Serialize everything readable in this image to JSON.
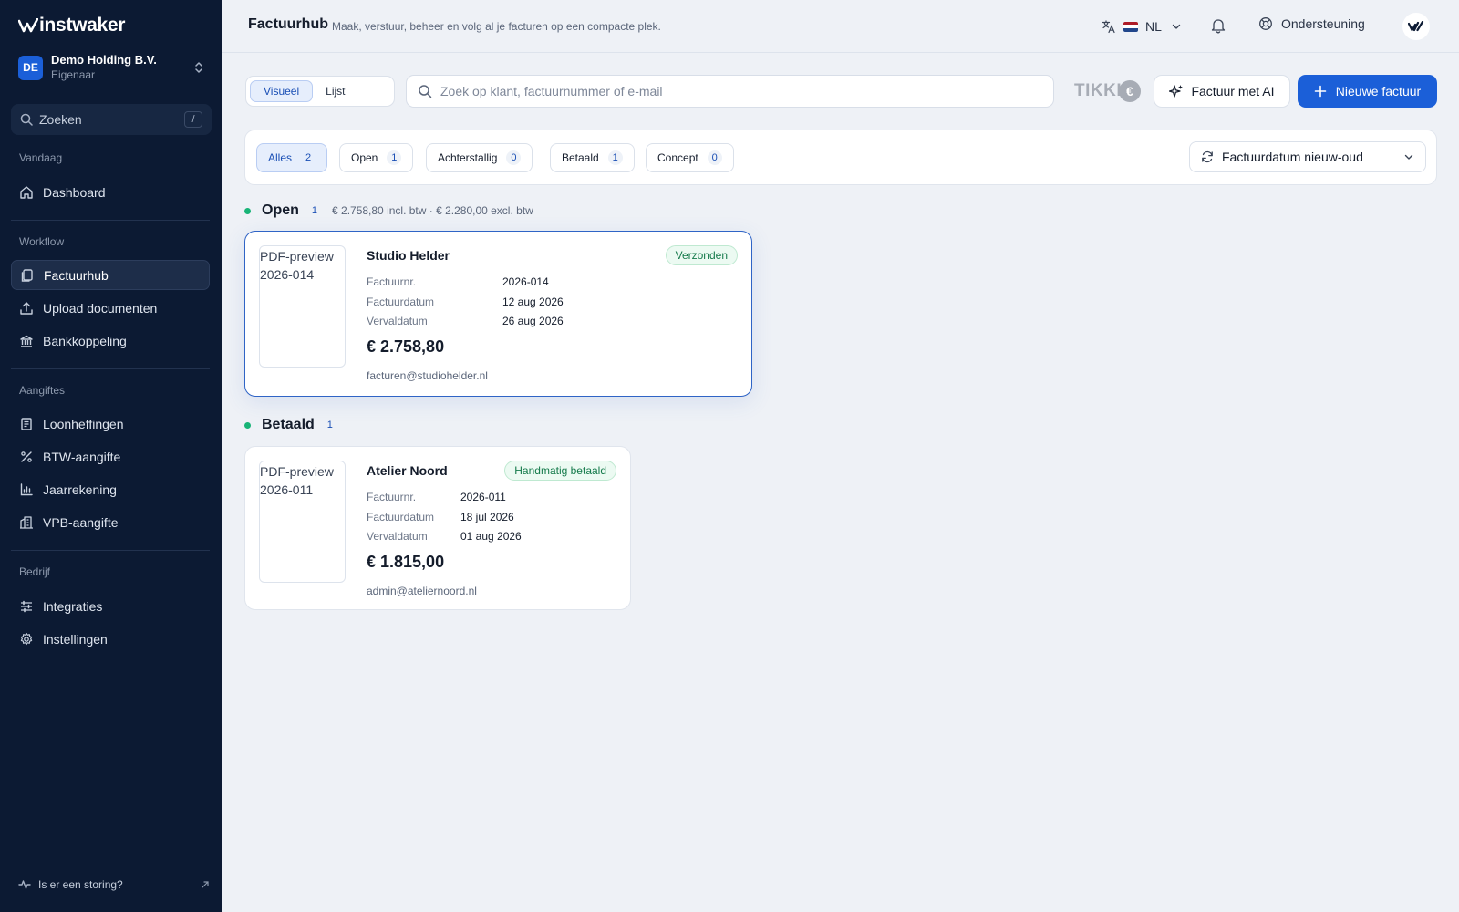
{
  "sidebar": {
    "brand": "instwaker",
    "org": {
      "initials": "DE",
      "name": "Demo Holding B.V.",
      "role": "Eigenaar"
    },
    "search": {
      "label": "Zoeken",
      "shortcut": "/"
    },
    "sections": {
      "today": "Vandaag",
      "workflow": "Workflow",
      "filings": "Aangiftes",
      "company": "Bedrijf"
    },
    "items": [
      {
        "label": "Dashboard",
        "icon": "home-icon"
      },
      {
        "label": "Factuurhub",
        "icon": "files-icon",
        "active": true
      },
      {
        "label": "Upload documenten",
        "icon": "upload-icon"
      },
      {
        "label": "Bankkoppeling",
        "icon": "bank-icon"
      },
      {
        "label": "Loonheffingen",
        "icon": "receipt-icon"
      },
      {
        "label": "BTW-aangifte",
        "icon": "percent-icon"
      },
      {
        "label": "Jaarrekening",
        "icon": "bar-chart-icon"
      },
      {
        "label": "VPB-aangifte",
        "icon": "building-icon"
      },
      {
        "label": "Integraties",
        "icon": "sliders-icon"
      },
      {
        "label": "Instellingen",
        "icon": "gear-icon"
      }
    ],
    "status_link": "Is er een storing?"
  },
  "header": {
    "title": "Factuurhub",
    "subtitle": "Maak, verstuur, beheer en volg al je facturen op een compacte plek.",
    "language": "NL",
    "support": "Ondersteuning"
  },
  "toolbar": {
    "view_visual": "Visueel",
    "view_list": "Lijst",
    "search_placeholder": "Zoek op klant, factuurnummer of e-mail",
    "tikkie": "TIKKI",
    "tikkie_coin": "€",
    "ai_button": "Factuur met AI",
    "new_button": "Nieuwe factuur"
  },
  "filters": [
    {
      "label": "Alles",
      "count": "2",
      "active": true
    },
    {
      "label": "Open",
      "count": "1"
    },
    {
      "label": "Achterstallig",
      "count": "0"
    },
    {
      "label": "Betaald",
      "count": "1"
    },
    {
      "label": "Concept",
      "count": "0"
    }
  ],
  "sort": {
    "label": "Factuurdatum nieuw-oud"
  },
  "groups": [
    {
      "title": "Open",
      "count": "1",
      "summary": "€ 2.758,80 incl. btw · € 2.280,00 excl. btw",
      "invoices": [
        {
          "preview_alt": "PDF-preview 2026-014",
          "client": "Studio Helder",
          "status": "Verzonden",
          "fields": [
            {
              "label": "Factuurnr.",
              "value": "2026-014"
            },
            {
              "label": "Factuurdatum",
              "value": "12 aug 2026"
            },
            {
              "label": "Vervaldatum",
              "value": "26 aug 2026"
            }
          ],
          "amount": "€ 2.758,80",
          "email": "facturen@studiohelder.nl"
        }
      ]
    },
    {
      "title": "Betaald",
      "count": "1",
      "summary": "",
      "invoices": [
        {
          "preview_alt": "PDF-preview 2026-011",
          "client": "Atelier Noord",
          "status": "Handmatig betaald",
          "fields": [
            {
              "label": "Factuurnr.",
              "value": "2026-011"
            },
            {
              "label": "Factuurdatum",
              "value": "18 jul 2026"
            },
            {
              "label": "Vervaldatum",
              "value": "01 aug 2026"
            }
          ],
          "amount": "€ 1.815,00",
          "email": "admin@ateliernoord.nl"
        }
      ]
    }
  ],
  "colors": {
    "accent": "#1b5fd8",
    "sidebar_bg": "#0c1a33",
    "status_green": "#18b477"
  }
}
